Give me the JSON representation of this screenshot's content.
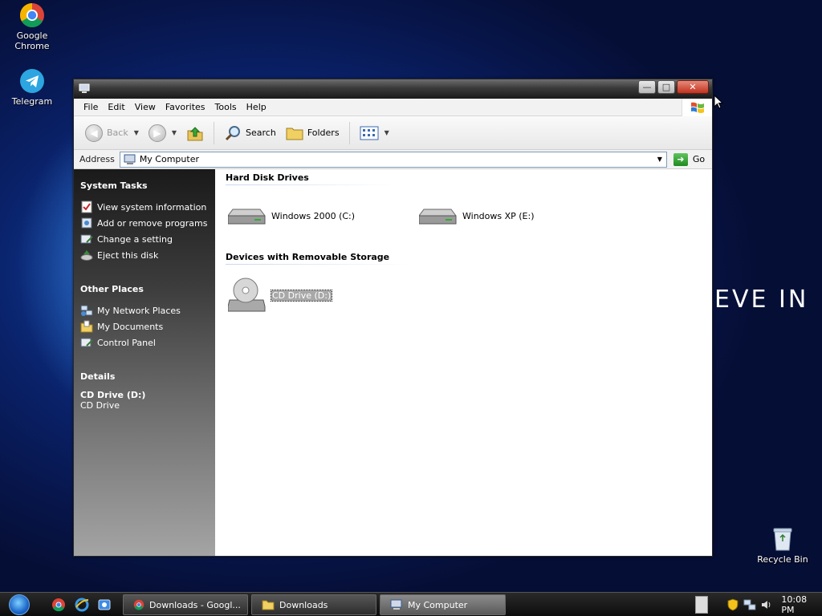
{
  "desktop": {
    "icons": [
      {
        "label": "Google Chrome",
        "icon": "chrome-icon"
      },
      {
        "label": "Telegram",
        "icon": "telegram-icon"
      },
      {
        "label": "Recycle Bin",
        "icon": "recycle-bin-icon"
      }
    ],
    "wallpaper_text": "EVE IN"
  },
  "window": {
    "title": "",
    "menu": [
      "File",
      "Edit",
      "View",
      "Favorites",
      "Tools",
      "Help"
    ],
    "toolbar": {
      "back": "Back",
      "search": "Search",
      "folders": "Folders"
    },
    "address": {
      "label": "Address",
      "value": "My Computer",
      "go": "Go"
    },
    "sidebar": {
      "system_tasks": {
        "title": "System Tasks",
        "items": [
          {
            "label": "View system information",
            "icon": "system-info-icon"
          },
          {
            "label": "Add or remove programs",
            "icon": "add-remove-programs-icon"
          },
          {
            "label": "Change a setting",
            "icon": "control-panel-icon"
          },
          {
            "label": "Eject this disk",
            "icon": "eject-icon"
          }
        ]
      },
      "other_places": {
        "title": "Other Places",
        "items": [
          {
            "label": "My Network Places",
            "icon": "network-places-icon"
          },
          {
            "label": "My Documents",
            "icon": "my-documents-icon"
          },
          {
            "label": "Control Panel",
            "icon": "control-panel-icon"
          }
        ]
      },
      "details": {
        "title": "Details",
        "name": "CD Drive (D:)",
        "type": "CD Drive"
      }
    },
    "content": {
      "groups": [
        {
          "title": "Hard Disk Drives",
          "items": [
            "Windows 2000 (C:)",
            "Windows XP (E:)"
          ]
        },
        {
          "title": "Devices with Removable Storage",
          "items": [
            "CD Drive (D:)"
          ]
        }
      ],
      "selected_item": "CD Drive (D:)"
    }
  },
  "taskbar": {
    "tasks": [
      {
        "label": "Downloads - Googl...",
        "icon": "chrome-icon"
      },
      {
        "label": "Downloads",
        "icon": "folder-icon"
      },
      {
        "label": "My Computer",
        "icon": "my-computer-icon",
        "active": true
      }
    ],
    "clock": "10:08 PM"
  },
  "colors": {
    "sidebar_top": "#1a1a1a",
    "sidebar_bottom": "#a4a4a4",
    "titlebar": "#2a2a2a",
    "close_button": "#c1321f",
    "go_button": "#1f8a1f"
  }
}
